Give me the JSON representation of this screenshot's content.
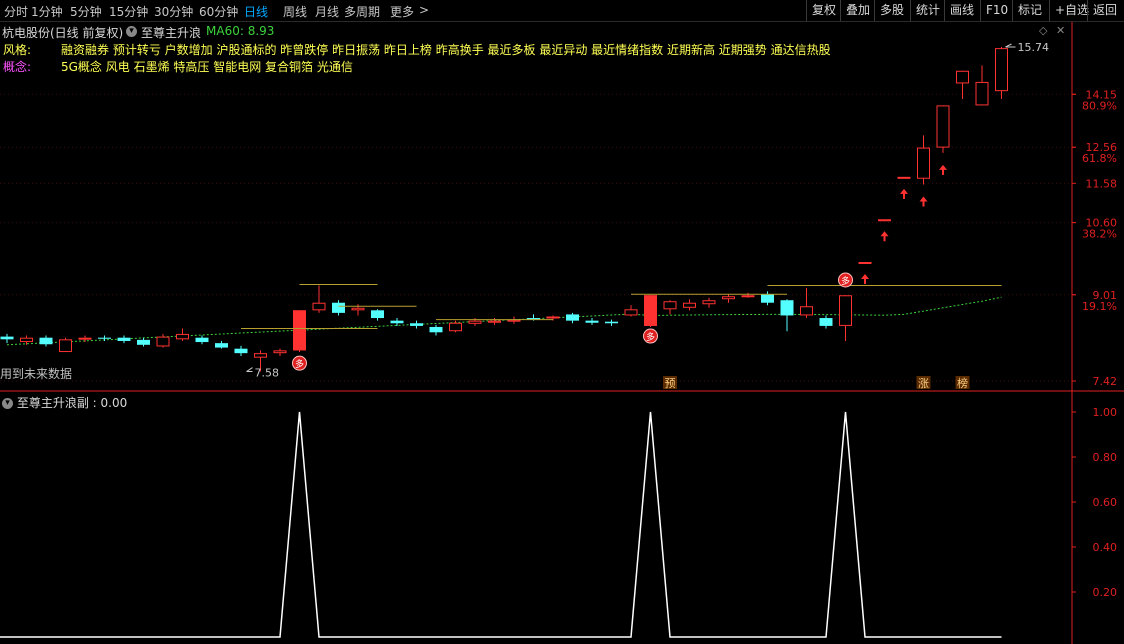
{
  "toolbar": {
    "periods": [
      "分时",
      "1分钟",
      "5分钟",
      "15分钟",
      "30分钟",
      "60分钟",
      "日线",
      "周线",
      "月线",
      "多周期",
      "更多"
    ],
    "active_period": "日线",
    "more_arrow": ">",
    "buttons": [
      "复权",
      "叠加",
      "多股",
      "统计",
      "画线",
      "F10",
      "标记",
      "+自选",
      "返回"
    ]
  },
  "header": {
    "stock_title": "杭电股份(日线 前复权)",
    "indicator_name": "至尊主升浪",
    "ma_label": "MA60: 8.93"
  },
  "style_row": {
    "label": "风格:",
    "text": "融资融券 预计转亏 户数增加 沪股通标的 昨曾跌停 昨日振荡 昨日上榜 昨高换手 最近多板 最近异动 最近情绪指数 近期新高 近期强势 通达信热股"
  },
  "concept_row": {
    "label": "概念:",
    "text": "5G概念 风电 石墨烯 特高压 智能电网 复合铜箔 光通信"
  },
  "future_data_note": "用到未来数据",
  "annotations": {
    "low_price": "7.58",
    "high_price": "15.74",
    "marker_yu": "预",
    "marker_zhang": "涨",
    "marker_bang": "榜",
    "badge_char": "多"
  },
  "price_axis": {
    "ticks": [
      "15.74",
      "14.15",
      "80.9%",
      "12.56",
      "61.8%",
      "11.58",
      "10.60",
      "38.2%",
      "9.01",
      "19.1%",
      "7.42"
    ]
  },
  "sub_indicator": {
    "title": "至尊主升浪副",
    "value": "0.00",
    "axis_ticks": [
      "1.00",
      "0.80",
      "0.60",
      "0.40",
      "0.20"
    ]
  },
  "colors": {
    "up": "#ff3232",
    "down": "#54ffff",
    "ma": "#3cd23c",
    "style_text": "#ffff54",
    "concept_text": "#ffff54",
    "concept_label": "#ff54ff",
    "axis_red": "#e02020"
  },
  "chart_data": [
    {
      "type": "candlestick",
      "title": "杭电股份(日线 前复权)",
      "ylim": [
        7.3,
        16.1
      ],
      "scale": "log",
      "series_ma": {
        "name": "MA60",
        "current": 8.93
      },
      "candles": [
        {
          "o": 8.2,
          "h": 8.25,
          "l": 8.08,
          "c": 8.15
        },
        {
          "o": 8.1,
          "h": 8.22,
          "l": 8.05,
          "c": 8.18
        },
        {
          "o": 8.18,
          "h": 8.22,
          "l": 8.02,
          "c": 8.06
        },
        {
          "o": 7.92,
          "h": 8.18,
          "l": 7.92,
          "c": 8.15
        },
        {
          "o": 8.15,
          "h": 8.22,
          "l": 8.1,
          "c": 8.18
        },
        {
          "o": 8.18,
          "h": 8.22,
          "l": 8.12,
          "c": 8.16
        },
        {
          "o": 8.18,
          "h": 8.22,
          "l": 8.08,
          "c": 8.12
        },
        {
          "o": 8.14,
          "h": 8.18,
          "l": 8.02,
          "c": 8.05
        },
        {
          "o": 8.02,
          "h": 8.25,
          "l": 8.0,
          "c": 8.2
        },
        {
          "o": 8.15,
          "h": 8.35,
          "l": 8.12,
          "c": 8.25
        },
        {
          "o": 8.18,
          "h": 8.22,
          "l": 8.06,
          "c": 8.1
        },
        {
          "o": 8.08,
          "h": 8.12,
          "l": 7.98,
          "c": 8.0
        },
        {
          "o": 7.98,
          "h": 8.03,
          "l": 7.85,
          "c": 7.9
        },
        {
          "o": 7.82,
          "h": 7.95,
          "l": 7.58,
          "c": 7.9
        },
        {
          "o": 7.9,
          "h": 7.98,
          "l": 7.85,
          "c": 7.95
        },
        {
          "o": 7.95,
          "h": 8.7,
          "l": 7.92,
          "c": 8.7
        },
        {
          "o": 8.7,
          "h": 9.2,
          "l": 8.65,
          "c": 8.85
        },
        {
          "o": 8.85,
          "h": 8.9,
          "l": 8.6,
          "c": 8.65
        },
        {
          "o": 8.7,
          "h": 8.82,
          "l": 8.6,
          "c": 8.75
        },
        {
          "o": 8.7,
          "h": 8.72,
          "l": 8.5,
          "c": 8.55
        },
        {
          "o": 8.5,
          "h": 8.55,
          "l": 8.4,
          "c": 8.45
        },
        {
          "o": 8.45,
          "h": 8.5,
          "l": 8.35,
          "c": 8.4
        },
        {
          "o": 8.38,
          "h": 8.42,
          "l": 8.22,
          "c": 8.28
        },
        {
          "o": 8.3,
          "h": 8.5,
          "l": 8.28,
          "c": 8.46
        },
        {
          "o": 8.44,
          "h": 8.55,
          "l": 8.4,
          "c": 8.5
        },
        {
          "o": 8.46,
          "h": 8.55,
          "l": 8.42,
          "c": 8.5
        },
        {
          "o": 8.48,
          "h": 8.58,
          "l": 8.44,
          "c": 8.52
        },
        {
          "o": 8.55,
          "h": 8.62,
          "l": 8.5,
          "c": 8.52
        },
        {
          "o": 8.55,
          "h": 8.6,
          "l": 8.5,
          "c": 8.58
        },
        {
          "o": 8.62,
          "h": 8.65,
          "l": 8.45,
          "c": 8.5
        },
        {
          "o": 8.5,
          "h": 8.55,
          "l": 8.42,
          "c": 8.46
        },
        {
          "o": 8.48,
          "h": 8.52,
          "l": 8.4,
          "c": 8.45
        },
        {
          "o": 8.6,
          "h": 8.8,
          "l": 8.58,
          "c": 8.72
        },
        {
          "o": 8.4,
          "h": 9.0,
          "l": 8.38,
          "c": 9.0
        },
        {
          "o": 8.72,
          "h": 8.9,
          "l": 8.62,
          "c": 8.88
        },
        {
          "o": 8.75,
          "h": 8.92,
          "l": 8.7,
          "c": 8.85
        },
        {
          "o": 8.82,
          "h": 8.95,
          "l": 8.75,
          "c": 8.9
        },
        {
          "o": 8.92,
          "h": 9.02,
          "l": 8.85,
          "c": 8.98
        },
        {
          "o": 9.0,
          "h": 9.05,
          "l": 8.95,
          "c": 9.0
        },
        {
          "o": 9.02,
          "h": 9.08,
          "l": 8.8,
          "c": 8.85
        },
        {
          "o": 8.9,
          "h": 8.92,
          "l": 8.3,
          "c": 8.6
        },
        {
          "o": 8.6,
          "h": 9.15,
          "l": 8.55,
          "c": 8.78
        },
        {
          "o": 8.55,
          "h": 8.6,
          "l": 8.35,
          "c": 8.4
        },
        {
          "o": 8.4,
          "h": 9.0,
          "l": 8.12,
          "c": 9.0
        },
        {
          "o": 9.7,
          "h": 9.7,
          "l": 9.7,
          "c": 9.7
        },
        {
          "o": 10.68,
          "h": 10.68,
          "l": 10.68,
          "c": 10.68
        },
        {
          "o": 11.75,
          "h": 11.75,
          "l": 11.75,
          "c": 11.75
        },
        {
          "o": 11.7,
          "h": 12.9,
          "l": 11.55,
          "c": 12.55
        },
        {
          "o": 12.55,
          "h": 13.8,
          "l": 12.4,
          "c": 13.8
        },
        {
          "o": 14.5,
          "h": 14.92,
          "l": 14.0,
          "c": 14.92
        },
        {
          "o": 13.8,
          "h": 15.1,
          "l": 13.8,
          "c": 14.55
        },
        {
          "o": 14.25,
          "h": 15.74,
          "l": 14.0,
          "c": 15.7
        }
      ]
    },
    {
      "type": "line",
      "title": "至尊主升浪副",
      "ylim": [
        0,
        1.1
      ],
      "values": [
        0,
        0,
        0,
        0,
        0,
        0,
        0,
        0,
        0,
        0,
        0,
        0,
        0,
        0,
        0,
        1,
        0,
        0,
        0,
        0,
        0,
        0,
        0,
        0,
        0,
        0,
        0,
        0,
        0,
        0,
        0,
        0,
        0,
        1,
        0,
        0,
        0,
        0,
        0,
        0,
        0,
        0,
        0,
        1,
        0,
        0,
        0,
        0,
        0,
        0,
        0,
        0
      ]
    }
  ]
}
